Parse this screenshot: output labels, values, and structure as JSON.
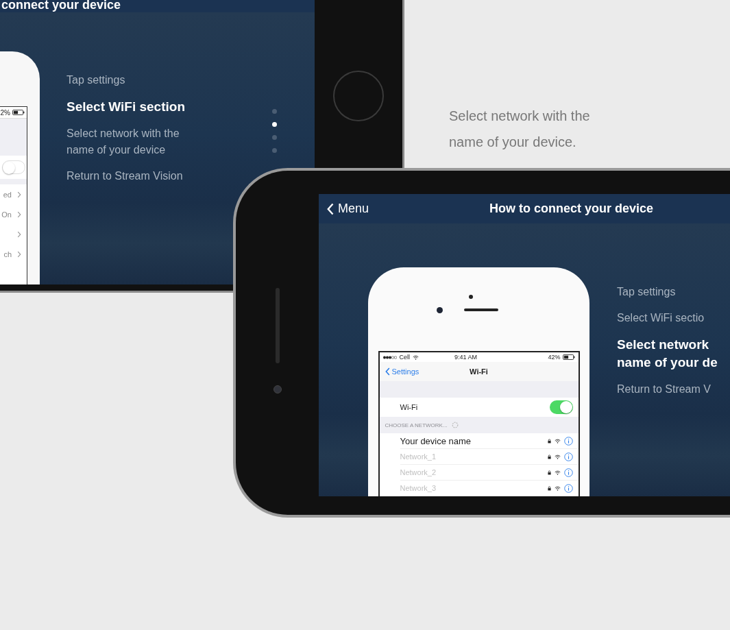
{
  "back_phone": {
    "header_title": "connect your device",
    "inner_screen": {
      "battery_percent": "2%",
      "toggle_on": false,
      "rows": [
        {
          "kind": "labeled",
          "label": "ed"
        },
        {
          "kind": "labeled",
          "label": "On"
        },
        {
          "kind": "chevron"
        },
        {
          "kind": "labeled",
          "label": "ch"
        }
      ]
    },
    "steps": [
      {
        "lines": [
          "Tap settings"
        ],
        "selected": false
      },
      {
        "lines": [
          "Select WiFi section"
        ],
        "selected": true
      },
      {
        "lines": [
          "Select network with the",
          "name of your device"
        ],
        "selected": false
      },
      {
        "lines": [
          "Return to Stream Vision"
        ],
        "selected": false
      }
    ],
    "dots": [
      {
        "selected": false
      },
      {
        "selected": true
      },
      {
        "selected": false
      },
      {
        "selected": false
      }
    ]
  },
  "caption": "Select network with the name of your device.",
  "front_phone": {
    "back_label": "Menu",
    "title": "How to connect your device",
    "inner_screen": {
      "carrier": "Cell",
      "time": "9:41 AM",
      "battery_percent": "42%",
      "back_label": "Settings",
      "nav_title": "Wi-Fi",
      "wifi_label": "Wi-Fi",
      "wifi_on": true,
      "section_header": "CHOOSE A NETWORK...",
      "networks": [
        {
          "name": "Your device name",
          "selected": true
        },
        {
          "name": "Network_1",
          "selected": false
        },
        {
          "name": "Network_2",
          "selected": false
        },
        {
          "name": "Network_3",
          "selected": false
        }
      ]
    },
    "steps": [
      {
        "lines": [
          "Tap settings"
        ],
        "selected": false
      },
      {
        "lines": [
          "Select WiFi sectio"
        ],
        "selected": false
      },
      {
        "lines": [
          "Select network",
          "name of your de"
        ],
        "selected": true
      },
      {
        "lines": [
          "Return to Stream V"
        ],
        "selected": false
      }
    ]
  }
}
